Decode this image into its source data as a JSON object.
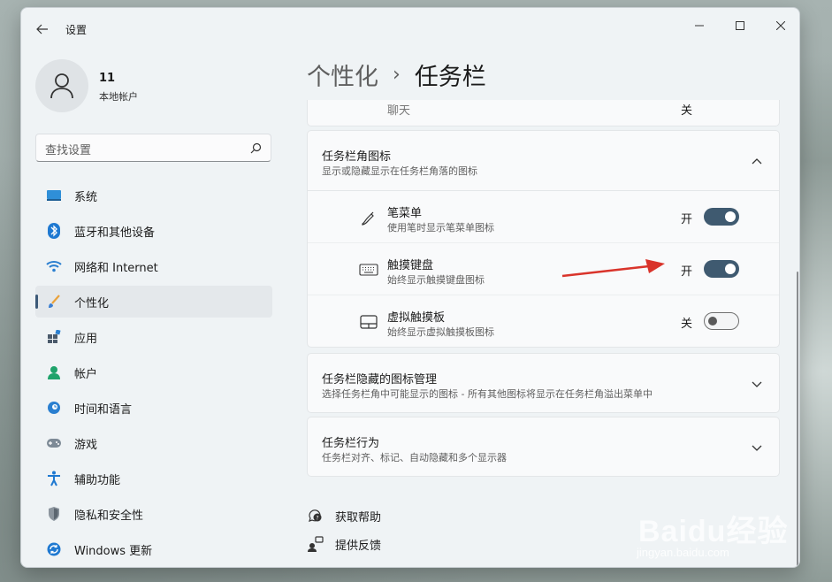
{
  "window": {
    "app_title": "设置",
    "controls": {
      "minimize": "minimize-icon",
      "maximize": "maximize-icon",
      "close": "close-icon"
    }
  },
  "profile": {
    "name": "11",
    "account_type": "本地帐户"
  },
  "search": {
    "placeholder": "查找设置"
  },
  "sidebar": {
    "items": [
      {
        "label": "系统",
        "icon": "system-icon",
        "active": false
      },
      {
        "label": "蓝牙和其他设备",
        "icon": "bluetooth-icon",
        "active": false
      },
      {
        "label": "网络和 Internet",
        "icon": "wifi-icon",
        "active": false
      },
      {
        "label": "个性化",
        "icon": "brush-icon",
        "active": true
      },
      {
        "label": "应用",
        "icon": "apps-icon",
        "active": false
      },
      {
        "label": "帐户",
        "icon": "account-icon",
        "active": false
      },
      {
        "label": "时间和语言",
        "icon": "time-language-icon",
        "active": false
      },
      {
        "label": "游戏",
        "icon": "gaming-icon",
        "active": false
      },
      {
        "label": "辅助功能",
        "icon": "accessibility-icon",
        "active": false
      },
      {
        "label": "隐私和安全性",
        "icon": "shield-icon",
        "active": false
      },
      {
        "label": "Windows 更新",
        "icon": "update-icon",
        "active": false
      }
    ]
  },
  "breadcrumb": {
    "parent": "个性化",
    "separator": "›",
    "current": "任务栏"
  },
  "main": {
    "previous_row": {
      "label": "聊天",
      "state": "关"
    },
    "corner_icons": {
      "title": "任务栏角图标",
      "description": "显示或隐藏显示在任务栏角落的图标",
      "rows": [
        {
          "title": "笔菜单",
          "description": "使用笔时显示笔菜单图标",
          "state": "开",
          "on": true,
          "icon": "pen-icon"
        },
        {
          "title": "触摸键盘",
          "description": "始终显示触摸键盘图标",
          "state": "开",
          "on": true,
          "icon": "keyboard-icon"
        },
        {
          "title": "虚拟触摸板",
          "description": "始终显示虚拟触摸板图标",
          "state": "关",
          "on": false,
          "icon": "touchpad-icon"
        }
      ]
    },
    "overflow": {
      "title": "任务栏隐藏的图标管理",
      "description": "选择任务栏角中可能显示的图标 - 所有其他图标将显示在任务栏角溢出菜单中"
    },
    "behavior": {
      "title": "任务栏行为",
      "description": "任务栏对齐、标记、自动隐藏和多个显示器"
    }
  },
  "links": {
    "help": "获取帮助",
    "feedback": "提供反馈"
  },
  "colors": {
    "accent": "#3f5a70",
    "arrow": "#d9342b",
    "window_bg": "#eff3f5",
    "card_bg": "#f9fafb"
  }
}
